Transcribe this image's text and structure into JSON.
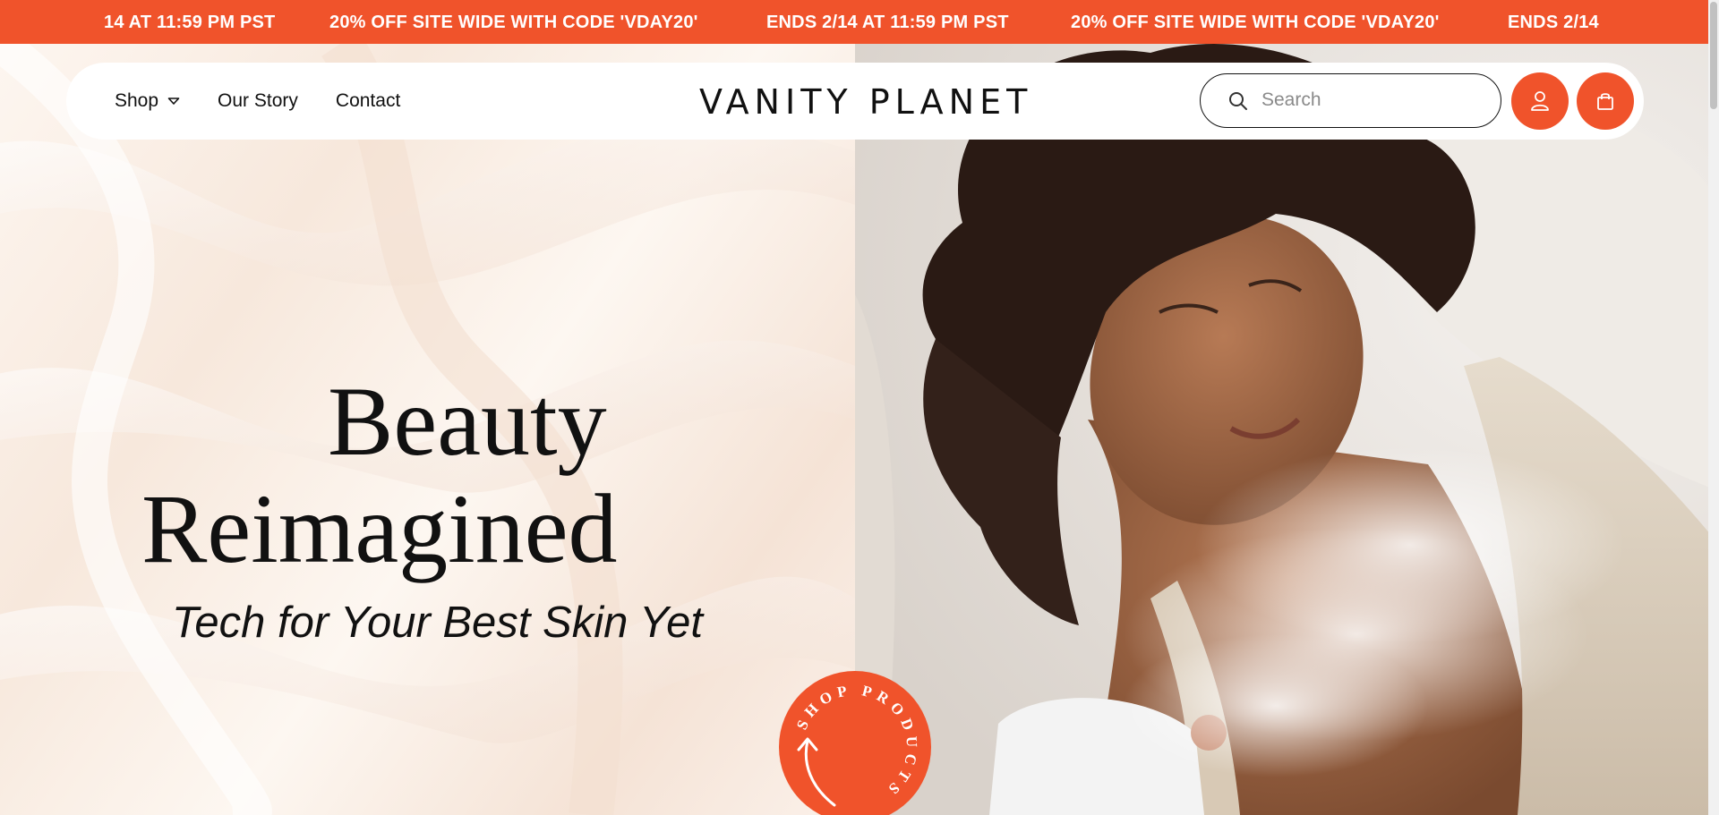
{
  "announcement": {
    "items": [
      "14 AT 11:59 PM PST",
      "20% OFF SITE WIDE WITH CODE 'VDAY20'",
      "ENDS 2/14 AT 11:59 PM PST",
      "20% OFF SITE WIDE WITH CODE 'VDAY20'",
      "ENDS 2/14"
    ],
    "background_color": "#f0532b"
  },
  "header": {
    "nav": {
      "shop_label": "Shop",
      "our_story_label": "Our Story",
      "contact_label": "Contact"
    },
    "logo_text": "VANITY PLANET",
    "search": {
      "placeholder": "Search",
      "value": ""
    },
    "account_icon": "user-icon",
    "cart_icon": "shopping-bag-icon",
    "accent_color": "#f0532b"
  },
  "hero": {
    "headline_line1": "Beauty",
    "headline_line2": "Reimagined",
    "subheadline": "Tech for Your Best Skin Yet",
    "badge_text": "SHOP PRODUCTS",
    "badge_icon": "curved-arrow-icon"
  }
}
